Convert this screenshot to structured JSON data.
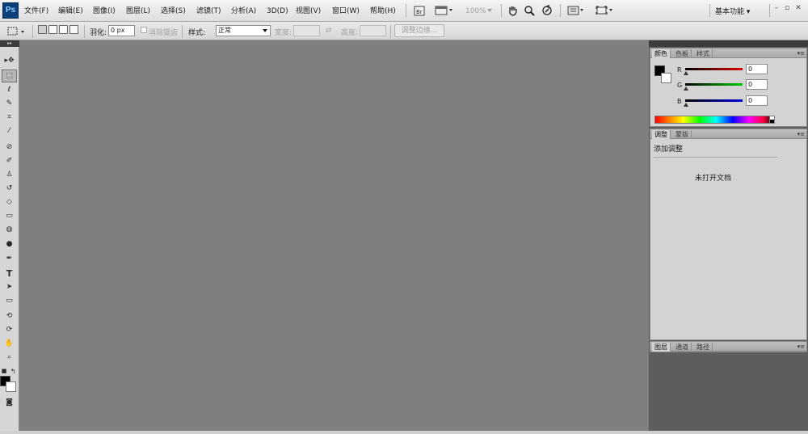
{
  "app": {
    "logo_text": "Ps"
  },
  "menu": {
    "items": [
      "文件(F)",
      "编辑(E)",
      "图像(I)",
      "图层(L)",
      "选择(S)",
      "滤镜(T)",
      "分析(A)",
      "3D(D)",
      "视图(V)",
      "窗口(W)",
      "帮助(H)"
    ],
    "zoom_level": "100%",
    "workspace": "基本功能 ▾",
    "window_controls": [
      "–",
      "▫",
      "✕"
    ]
  },
  "options_bar": {
    "feather_label": "羽化:",
    "feather_value": "0 px",
    "antialias_label": "消除锯齿",
    "style_label": "样式:",
    "style_value": "正常",
    "width_label": "宽度:",
    "height_label": "高度:",
    "refine_edge_label": "调整边缘..."
  },
  "toolbox": {
    "tools": [
      {
        "name": "move-tool",
        "glyph": "▸✥"
      },
      {
        "name": "marquee-tool",
        "glyph": "⬚"
      },
      {
        "name": "lasso-tool",
        "glyph": "ℓ"
      },
      {
        "name": "quick-select-tool",
        "glyph": "✎"
      },
      {
        "name": "crop-tool",
        "glyph": "⌗"
      },
      {
        "name": "eyedropper-tool",
        "glyph": "⁄"
      },
      {
        "name": "healing-brush-tool",
        "glyph": "⊘"
      },
      {
        "name": "brush-tool",
        "glyph": "✐"
      },
      {
        "name": "clone-stamp-tool",
        "glyph": "♙"
      },
      {
        "name": "history-brush-tool",
        "glyph": "↺"
      },
      {
        "name": "eraser-tool",
        "glyph": "◇"
      },
      {
        "name": "gradient-tool",
        "glyph": "▭"
      },
      {
        "name": "blur-tool",
        "glyph": "◍"
      },
      {
        "name": "dodge-tool",
        "glyph": "●"
      },
      {
        "name": "pen-tool",
        "glyph": "✒"
      },
      {
        "name": "type-tool",
        "glyph": "T"
      },
      {
        "name": "path-select-tool",
        "glyph": "➤"
      },
      {
        "name": "shape-tool",
        "glyph": "▭"
      },
      {
        "name": "3d-rotate-tool",
        "glyph": "⟲"
      },
      {
        "name": "3d-orbit-tool",
        "glyph": "⟳"
      },
      {
        "name": "hand-tool",
        "glyph": "✋"
      },
      {
        "name": "zoom-tool",
        "glyph": "⌕"
      }
    ]
  },
  "color_panel": {
    "tabs": [
      "颜色",
      "色板",
      "样式"
    ],
    "channels": [
      {
        "label": "R",
        "value": "0",
        "color": "#e00000"
      },
      {
        "label": "G",
        "value": "0",
        "color": "#00c800"
      },
      {
        "label": "B",
        "value": "0",
        "color": "#0000e0"
      }
    ],
    "foreground": "#000000",
    "background": "#ffffff"
  },
  "adjustments_panel": {
    "tabs": [
      "调整",
      "蒙版"
    ],
    "heading": "添加调整",
    "message": "未打开文档"
  },
  "layers_panel": {
    "tabs": [
      "图层",
      "通道",
      "路径"
    ]
  },
  "colors": {
    "canvas_bg": "#7f7f7f",
    "panel_bg": "#d3d3d3",
    "logo_bg": "#0b3f7a"
  }
}
